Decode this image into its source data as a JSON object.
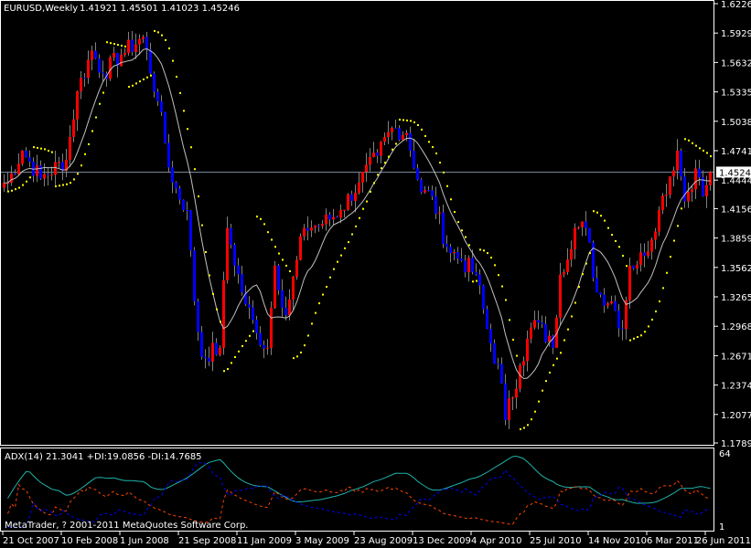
{
  "header": {
    "symbol": "EURUSD,Weekly",
    "ohlc": "1.41921 1.45501 1.41023 1.45246"
  },
  "price_axis": {
    "ticks": [
      "1.62260",
      "1.59290",
      "1.56320",
      "1.53350",
      "1.50380",
      "1.47410",
      "1.44440",
      "1.41560",
      "1.38590",
      "1.35620",
      "1.32650",
      "1.29680",
      "1.26710",
      "1.23740",
      "1.20770",
      "1.17890"
    ],
    "max": 1.6226,
    "min": 1.1789,
    "current_price": "1.45246",
    "current_value": 1.45246
  },
  "indicator": {
    "label": "ADX(14) 21.3041 +DI:19.0856 -DI:14.7685",
    "max_label": "64",
    "min_label": "1",
    "max": 64,
    "min": 1
  },
  "copyright": "MetaTrader, ? 2001-2011 MetaQuotes Software Corp.",
  "time_axis": [
    "21 Oct 2007",
    "10 Feb 2008",
    "1 Jun 2008",
    "21 Sep 2008",
    "11 Jan 2009",
    "3 May 2009",
    "23 Aug 2009",
    "13 Dec 2009",
    "4 Apr 2010",
    "25 Jul 2010",
    "14 Nov 2010",
    "6 Mar 2011",
    "26 Jun 2011"
  ],
  "colors": {
    "bull": "#ff0000",
    "bear": "#0000ff",
    "ma": "#c0c0c0",
    "sar": "#ffff00",
    "adx": "#20b2aa",
    "plus_di": "#ff4500",
    "minus_di": "#0000ff",
    "grid": "#ffffff",
    "price_line": "#778899"
  },
  "chart_data": {
    "type": "candlestick",
    "title": "EURUSD,Weekly",
    "ylim": [
      1.1789,
      1.6226
    ],
    "key_closes_approx": [
      1.4418,
      1.474,
      1.446,
      1.465,
      1.534,
      1.575,
      1.552,
      1.571,
      1.589,
      1.524,
      1.442,
      1.414,
      1.322,
      1.266,
      1.275,
      1.396,
      1.331,
      1.29,
      1.275,
      1.358,
      1.308,
      1.396,
      1.4,
      1.414,
      1.442,
      1.469,
      1.497,
      1.492,
      1.432,
      1.428,
      1.377,
      1.363,
      1.349,
      1.294,
      1.239,
      1.202,
      1.257,
      1.303,
      1.275,
      1.349,
      1.396,
      1.396,
      1.331,
      1.322,
      1.294,
      1.358,
      1.368,
      1.414,
      1.474,
      1.423,
      1.456,
      1.428,
      1.45246
    ],
    "key_closes_week_index": [
      1,
      5,
      10,
      17,
      20,
      24,
      27,
      32,
      38,
      42,
      46,
      50,
      52,
      54,
      59,
      61,
      65,
      69,
      72,
      74,
      77,
      82,
      87,
      92,
      97,
      102,
      106,
      110,
      114,
      117,
      121,
      125,
      129,
      132,
      136,
      137,
      141,
      145,
      150,
      152,
      156,
      159,
      162,
      166,
      169,
      171,
      175,
      179,
      184,
      186,
      189,
      191,
      193
    ],
    "indicators": [
      "Moving Average",
      "Parabolic SAR",
      "ADX(14)"
    ]
  }
}
